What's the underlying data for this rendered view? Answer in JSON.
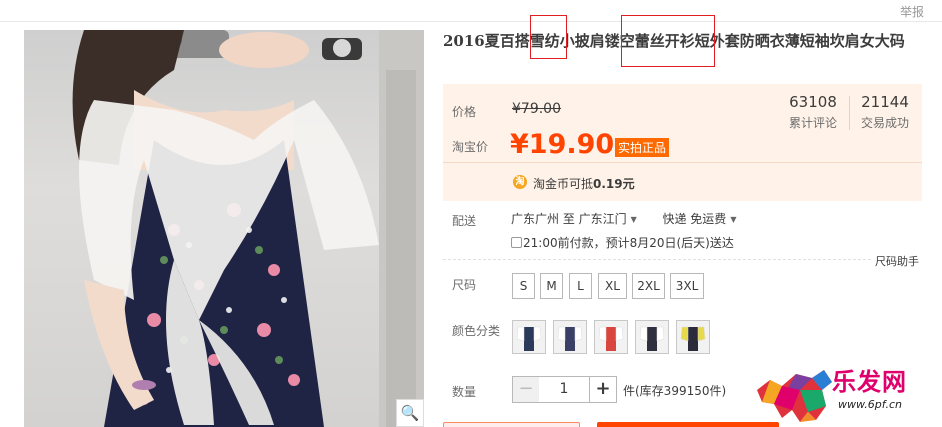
{
  "header": {
    "report_label": "举报"
  },
  "product": {
    "title": "2016夏百搭雪纺小披肩镂空蕾丝开衫短外套防晒衣薄短袖坎肩女大码"
  },
  "price": {
    "price_label": "价格",
    "original": "¥79.00",
    "taobao_price_label": "淘宝价",
    "current": "¥19.90",
    "genuine_badge": "实拍正品",
    "reviews_count": "63108",
    "reviews_label": "累计评论",
    "sales_count": "21144",
    "sales_label": "交易成功",
    "coin_icon_glyph": "淘",
    "coin_text": "淘金币可抵",
    "coin_amount": "0.19元"
  },
  "shipping": {
    "label": "配送",
    "from": "广东广州 至",
    "to": "广东江门",
    "method": "快递 免运费",
    "eta": "21:00前付款，预计8月20日(后天)送达"
  },
  "size": {
    "label": "尺码",
    "help": "尺码助手",
    "options": [
      "S",
      "M",
      "L",
      "XL",
      "2XL",
      "3XL"
    ]
  },
  "color": {
    "label": "颜色分类",
    "swatch_colors": [
      "#2b3a5a",
      "#3a3f66",
      "#d9463e",
      "#2f2f3f",
      "#e6d94a"
    ]
  },
  "quantity": {
    "label": "数量",
    "minus": "−",
    "value": "1",
    "plus": "+",
    "stock": "件(库存399150件)"
  },
  "watermark": {
    "text": "乐发网",
    "url": "www.6pf.cn"
  },
  "gallery": {
    "zoom_glyph": "🔍"
  },
  "colors": {
    "accent": "#ff4400",
    "price_bg": "#fff2e8",
    "highlight_box": "#e02020"
  }
}
